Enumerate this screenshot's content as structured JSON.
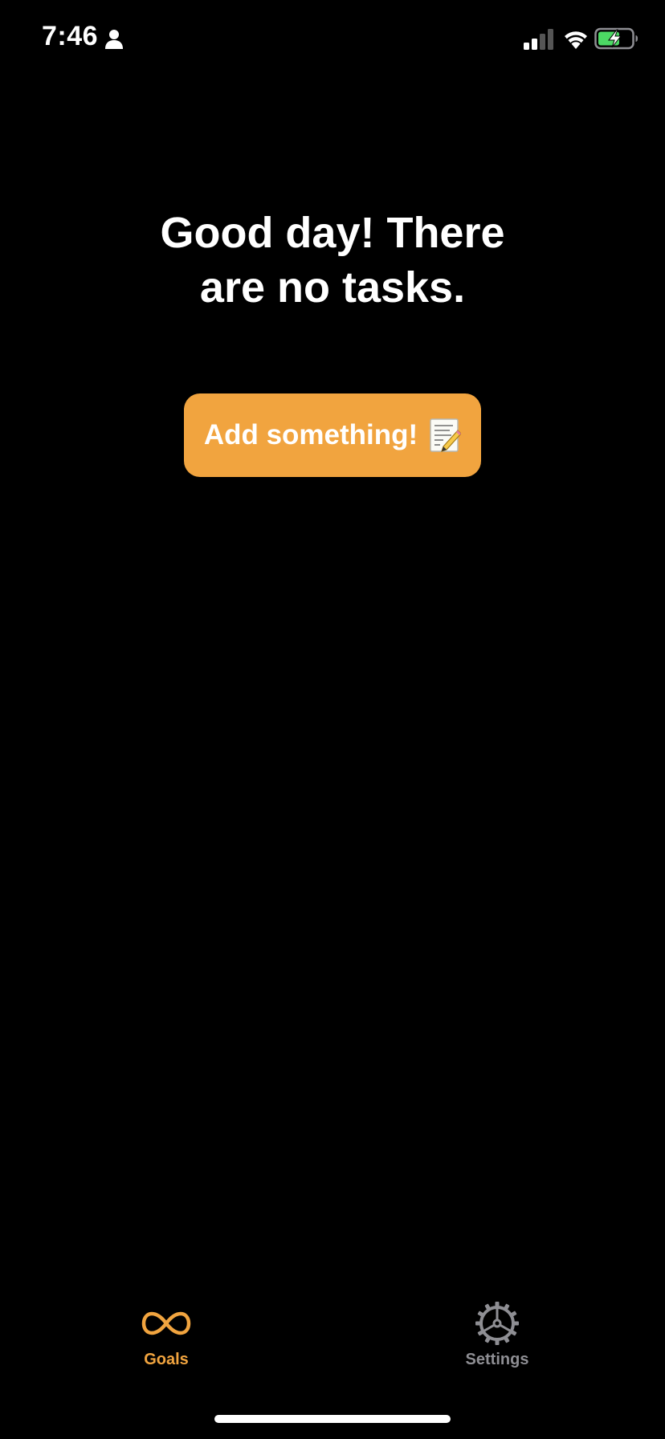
{
  "status_bar": {
    "time": "7:46",
    "icons": [
      "person-icon",
      "cellular-signal-icon",
      "wifi-icon",
      "battery-charging-icon"
    ]
  },
  "empty_state": {
    "headline_line1": "Good day! There",
    "headline_line2": "are no tasks."
  },
  "add_button": {
    "label": "Add something!",
    "icon": "memo-icon"
  },
  "tab_bar": {
    "tabs": [
      {
        "label": "Goals",
        "icon": "infinity-icon",
        "selected": true
      },
      {
        "label": "Settings",
        "icon": "gear-icon",
        "selected": false
      }
    ]
  },
  "colors": {
    "background": "#000000",
    "accent": "#f1a43f",
    "inactive_tab": "#8e8e93",
    "battery_fill": "#4cd964"
  }
}
